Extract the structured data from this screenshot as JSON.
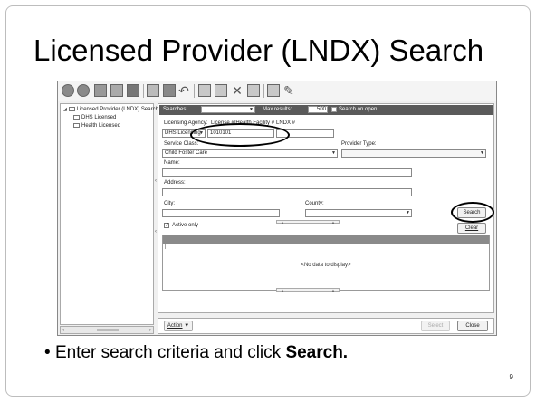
{
  "slide": {
    "title": "Licensed Provider (LNDX) Search",
    "bullet_text": "Enter search criteria and click ",
    "bullet_bold": "Search.",
    "page_number": "9"
  },
  "tree": {
    "root": "Licensed Provider (LNDX) Search",
    "children": [
      "DHS Licensed",
      "Health Licensed"
    ]
  },
  "header_bar": {
    "searches_label": "Searches:",
    "max_results_label": "Max results:",
    "max_results_value": "500",
    "search_on_open_label": "Search on open"
  },
  "form": {
    "licensing_agency_label": "Licensing Agency:",
    "license_number_label": "License #/Health Facility #",
    "lndx_label": "LNDX #",
    "licensing_agency_value": "DHS Licensing",
    "license_number_value": "1010101",
    "service_class_label": "Service Class:",
    "service_class_value": "Child Foster Care",
    "provider_type_label": "Provider Type:",
    "name_label": "Name:",
    "address_label": "Address:",
    "city_label": "City:",
    "county_label": "County:",
    "active_only_label": "Active only",
    "active_only_checked": true
  },
  "buttons": {
    "search": "Search",
    "clear": "Clear",
    "action": "Action",
    "select": "Select",
    "close": "Close"
  },
  "results": {
    "empty_message": "<No data to display>"
  }
}
